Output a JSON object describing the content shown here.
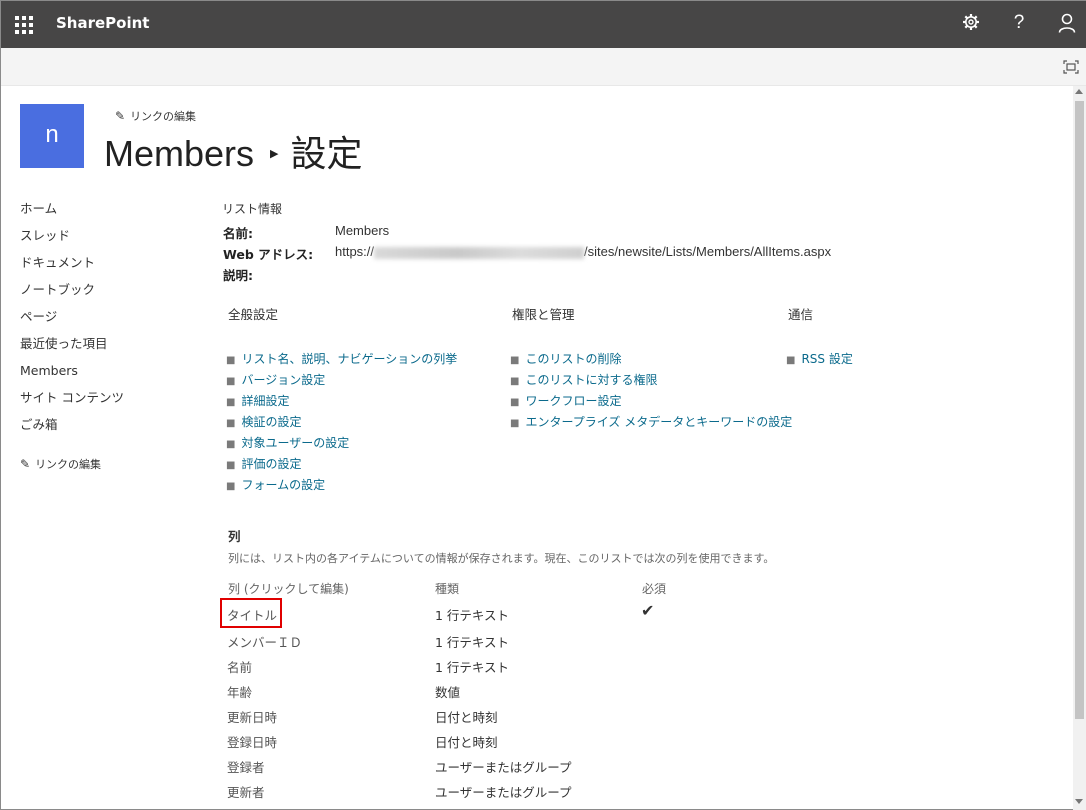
{
  "app": {
    "brand": "SharePoint"
  },
  "topbar": {
    "settings_icon": "gear-icon",
    "help_label": "?",
    "profile_icon": "person-icon"
  },
  "header": {
    "edit_link": "リンクの編集",
    "logo_letter": "n",
    "site_title": "Members",
    "page_title": "設定"
  },
  "nav": {
    "items": [
      "ホーム",
      "スレッド",
      "ドキュメント",
      "ノートブック",
      "ページ",
      "最近使った項目",
      "Members",
      "サイト コンテンツ",
      "ごみ箱"
    ],
    "edit_link": "リンクの編集"
  },
  "list_info": {
    "heading": "リスト情報",
    "name_label": "名前:",
    "name_value": "Members",
    "web_label": "Web アドレス:",
    "web_prefix": "https://",
    "web_suffix": "/sites/newsite/Lists/Members/AllItems.aspx",
    "desc_label": "説明:"
  },
  "sections": {
    "general": {
      "heading": "全般設定",
      "links": [
        "リスト名、説明、ナビゲーションの列挙",
        "バージョン設定",
        "詳細設定",
        "検証の設定",
        "対象ユーザーの設定",
        "評価の設定",
        "フォームの設定"
      ]
    },
    "permissions": {
      "heading": "権限と管理",
      "links": [
        "このリストの削除",
        "このリストに対する権限",
        "ワークフロー設定",
        "エンタープライズ メタデータとキーワードの設定"
      ]
    },
    "communication": {
      "heading": "通信",
      "links": [
        "RSS 設定"
      ]
    }
  },
  "columns": {
    "heading": "列",
    "description": "列には、リスト内の各アイテムについての情報が保存されます。現在、このリストでは次の列を使用できます。",
    "headers": {
      "name": "列 (クリックして編集)",
      "type": "種類",
      "required": "必須"
    },
    "rows": [
      {
        "name": "タイトル",
        "type": "1 行テキスト",
        "required": "✔"
      },
      {
        "name": "メンバーＩＤ",
        "type": "1 行テキスト",
        "required": ""
      },
      {
        "name": "名前",
        "type": "1 行テキスト",
        "required": ""
      },
      {
        "name": "年齢",
        "type": "数値",
        "required": ""
      },
      {
        "name": "更新日時",
        "type": "日付と時刻",
        "required": ""
      },
      {
        "name": "登録日時",
        "type": "日付と時刻",
        "required": ""
      },
      {
        "name": "登録者",
        "type": "ユーザーまたはグループ",
        "required": ""
      },
      {
        "name": "更新者",
        "type": "ユーザーまたはグループ",
        "required": ""
      }
    ]
  },
  "colors": {
    "suitebar": "#474646",
    "logo": "#4a6ee0",
    "link": "#0b6a8c",
    "highlight": "#e00000"
  }
}
